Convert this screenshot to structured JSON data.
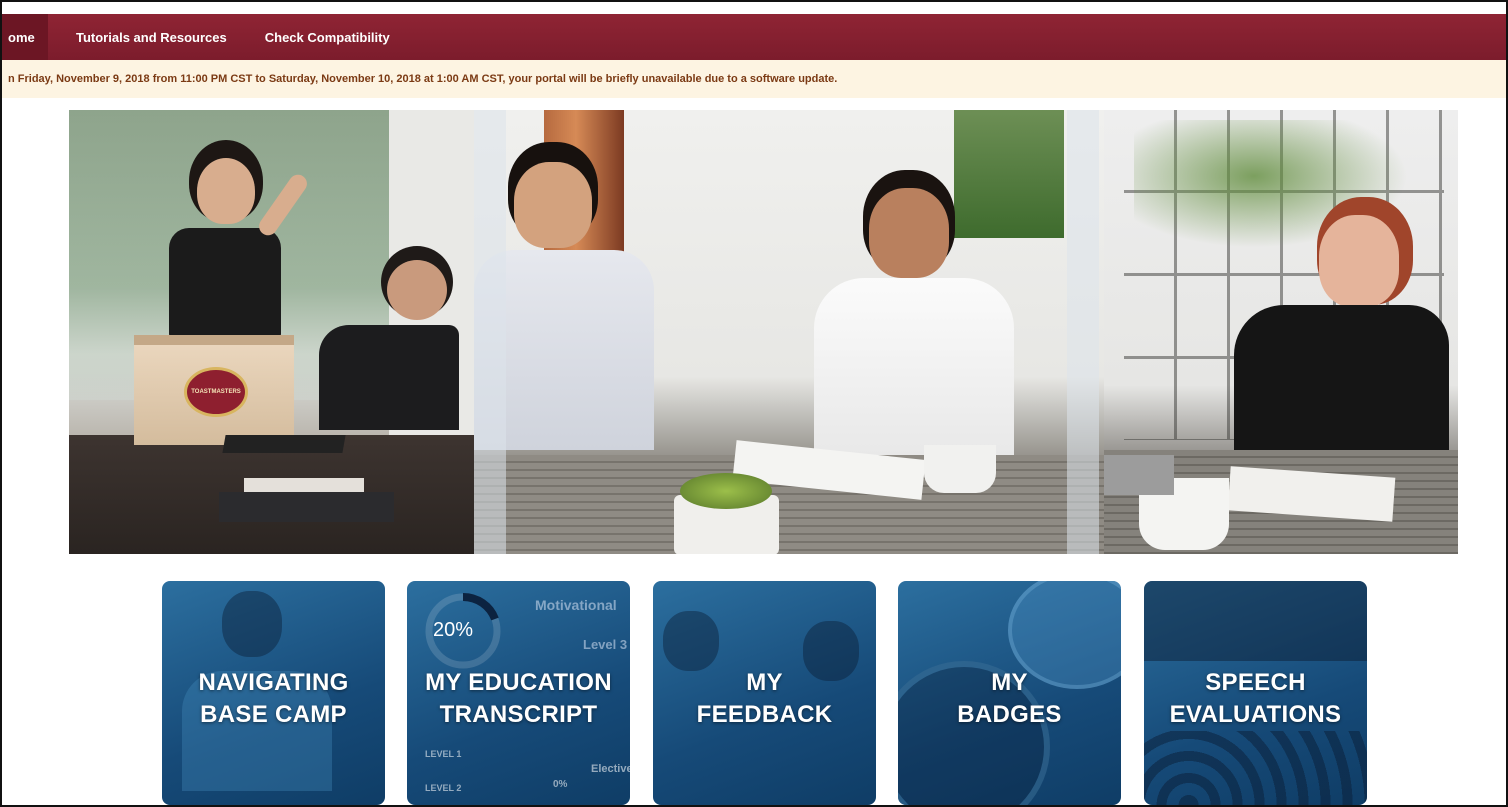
{
  "nav": {
    "items": [
      {
        "label": "ome"
      },
      {
        "label": "Tutorials and Resources"
      },
      {
        "label": "Check Compatibility"
      }
    ]
  },
  "notice": {
    "text": "n Friday, November 9, 2018 from 11:00 PM CST to Saturday, November 10, 2018 at 1:00 AM CST, your portal will be briefly unavailable due to a software update."
  },
  "hero": {
    "podium_text": "TOASTMASTERS"
  },
  "tiles": [
    {
      "line1": "NAVIGATING",
      "line2": "BASE CAMP"
    },
    {
      "line1": "MY EDUCATION",
      "line2": "TRANSCRIPT",
      "percent": "20%",
      "bg_title": "Motivational",
      "bg_level": "Level 3",
      "bg_rows": [
        "LEVEL 1",
        "LEVEL 2"
      ],
      "bg_elective": "Elective",
      "bg_zero": "0%"
    },
    {
      "line1": "MY",
      "line2": "FEEDBACK"
    },
    {
      "line1": "MY",
      "line2": "BADGES"
    },
    {
      "line1": "SPEECH",
      "line2": "EVALUATIONS"
    }
  ],
  "colors": {
    "nav_bg": "#861f30",
    "notice_bg": "#fdf4e2",
    "notice_text": "#7b3a14",
    "tile_blue": "#164a78"
  }
}
